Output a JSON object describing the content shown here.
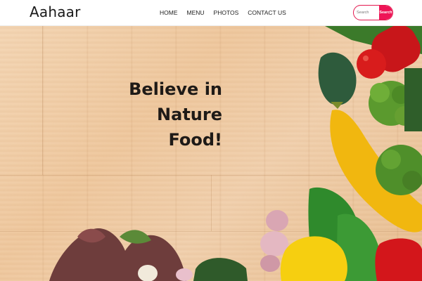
{
  "navbar": {
    "brand": "Aahaar",
    "links": [
      {
        "label": "HOME"
      },
      {
        "label": "MENU"
      },
      {
        "label": "PHOTOS"
      },
      {
        "label": "CONTACT US"
      }
    ],
    "search": {
      "placeholder": "Search",
      "button_label": "Search"
    }
  },
  "hero": {
    "headline_line1": "Believe in Nature",
    "headline_line2": "Food!",
    "image_subject": "fresh vegetables on a wooden board"
  },
  "colors": {
    "accent": "#ee1557",
    "text_dark": "#1e1a17",
    "wood_light": "#f1d0ad",
    "wood_dark": "#e8be90"
  },
  "icons": [
    "vegetables-photo"
  ]
}
